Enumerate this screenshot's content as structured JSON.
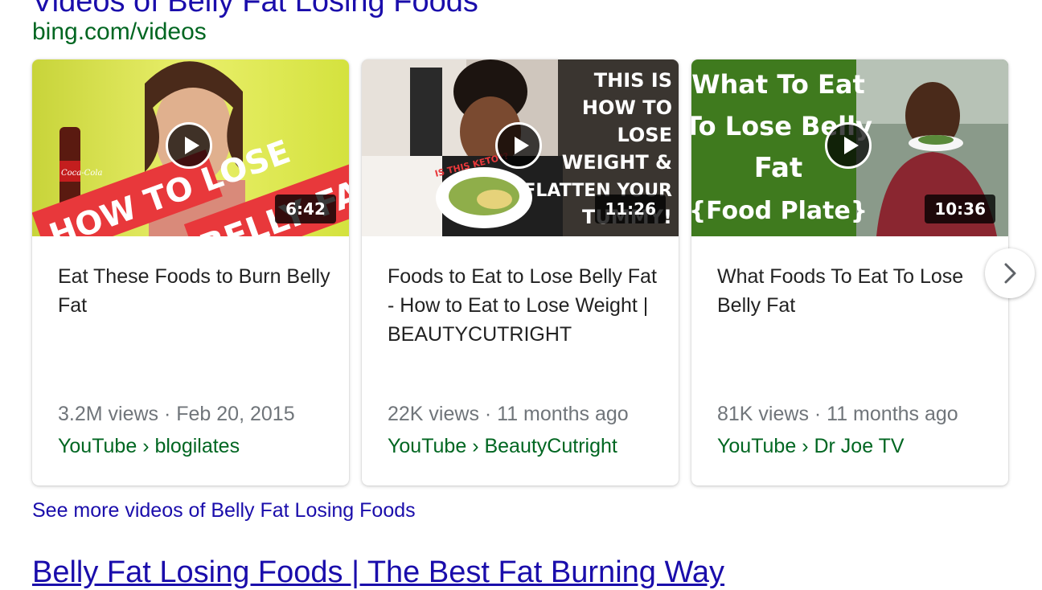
{
  "section": {
    "title": "Videos of Belly Fat Losing Foods",
    "source": "bing.com/videos"
  },
  "videos": [
    {
      "title": "Eat These Foods to Burn Belly Fat",
      "duration": "6:42",
      "views": "3.2M views",
      "date": "Feb 20, 2015",
      "meta": "3.2M views · Feb 20, 2015",
      "channel": "YouTube › blogilates",
      "thumbnail_text": [
        "HOW TO LOSE",
        "BELLY FAT"
      ],
      "thumbnail_brand": "Coca-Cola"
    },
    {
      "title": "Foods to Eat to Lose Belly Fat - How to Eat to Lose Weight | BEAUTYCUTRIGHT",
      "duration": "11:26",
      "views": "22K views",
      "date": "11 months ago",
      "meta": "22K views · 11 months ago",
      "channel": "YouTube › BeautyCutright",
      "thumbnail_text": [
        "THIS IS",
        "HOW TO",
        "LOSE",
        "WEIGHT &",
        "FLATTEN YOUR",
        "TUMMY!",
        "IS THIS KETO??"
      ]
    },
    {
      "title": "What Foods To Eat To Lose Belly Fat",
      "duration": "10:36",
      "views": "81K views",
      "date": "11 months ago",
      "meta": "81K views · 11 months ago",
      "channel": "YouTube › Dr Joe TV",
      "thumbnail_text": [
        "What To Eat",
        "To Lose Belly",
        "Fat",
        "{Food Plate}"
      ]
    }
  ],
  "see_more": "See more videos of Belly Fat Losing Foods",
  "next_result_title": "Belly Fat Losing Foods | The Best Fat Burning Way",
  "icons": {
    "play": "play-icon",
    "next": "chevron-right-icon"
  },
  "colors": {
    "link": "#1a0dab",
    "url_green": "#006621",
    "meta_gray": "#70757a",
    "thumb1_red": "#e8383b",
    "thumb1_yellow": "#d8e84a",
    "thumb3_green": "#3f7a1e"
  }
}
